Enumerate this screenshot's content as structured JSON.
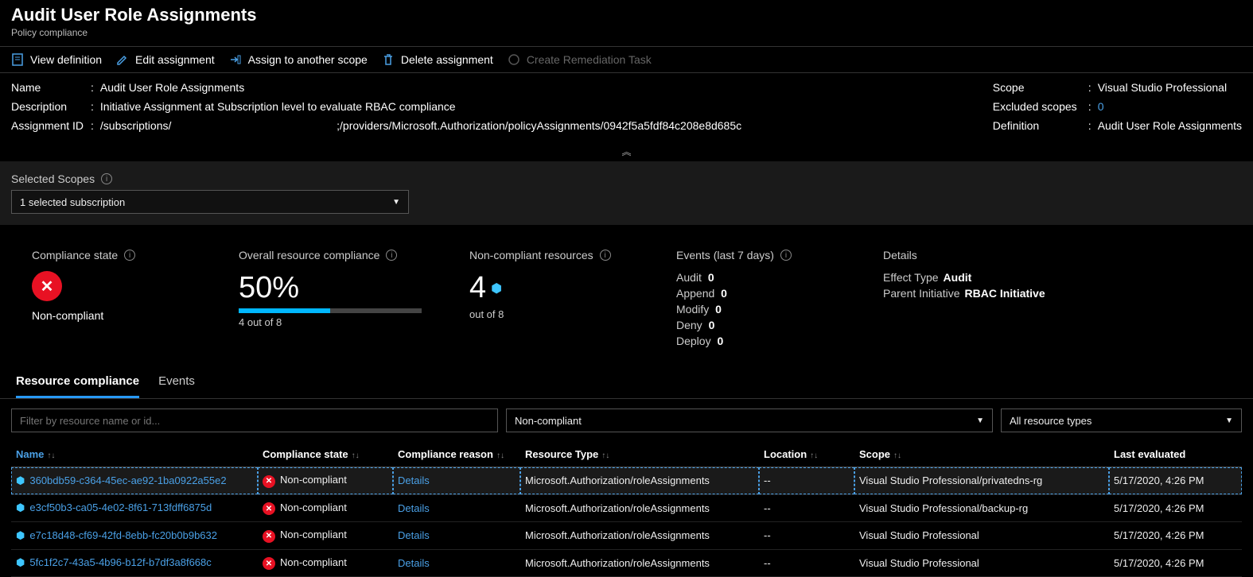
{
  "header": {
    "title": "Audit User Role Assignments",
    "subtitle": "Policy compliance"
  },
  "toolbar": {
    "view_definition": "View definition",
    "edit_assignment": "Edit assignment",
    "assign_scope": "Assign to another scope",
    "delete_assignment": "Delete assignment",
    "create_remediation": "Create Remediation Task"
  },
  "properties_left": {
    "name_label": "Name",
    "name_value": "Audit User Role Assignments",
    "description_label": "Description",
    "description_value": "Initiative Assignment at Subscription level to evaluate RBAC compliance",
    "assignment_id_label": "Assignment ID",
    "assignment_id_prefix": "/subscriptions/",
    "assignment_id_rest": ";/providers/Microsoft.Authorization/policyAssignments/0942f5a5fdf84c208e8d685c"
  },
  "properties_right": {
    "scope_label": "Scope",
    "scope_value": "Visual Studio Professional",
    "excluded_label": "Excluded scopes",
    "excluded_value": "0",
    "definition_label": "Definition",
    "definition_value": "Audit User Role Assignments"
  },
  "scopes": {
    "label": "Selected Scopes",
    "selected": "1 selected subscription"
  },
  "metrics": {
    "compliance_state_label": "Compliance state",
    "compliance_state_value": "Non-compliant",
    "overall_label": "Overall resource compliance",
    "overall_pct": "50%",
    "overall_sub": "4 out of 8",
    "noncompliant_label": "Non-compliant resources",
    "noncompliant_value": "4",
    "noncompliant_sub": "out of 8",
    "events_label": "Events (last 7 days)",
    "events": {
      "audit": "Audit",
      "audit_v": "0",
      "append": "Append",
      "append_v": "0",
      "modify": "Modify",
      "modify_v": "0",
      "deny": "Deny",
      "deny_v": "0",
      "deploy": "Deploy",
      "deploy_v": "0"
    },
    "details_label": "Details",
    "details": {
      "effect_k": "Effect Type",
      "effect_v": "Audit",
      "parent_k": "Parent Initiative",
      "parent_v": "RBAC Initiative"
    }
  },
  "tabs": {
    "resource_compliance": "Resource compliance",
    "events": "Events"
  },
  "filters": {
    "placeholder": "Filter by resource name or id...",
    "compliance_filter": "Non-compliant",
    "type_filter": "All resource types"
  },
  "columns": {
    "name": "Name",
    "compliance_state": "Compliance state",
    "compliance_reason": "Compliance reason",
    "resource_type": "Resource Type",
    "location": "Location",
    "scope": "Scope",
    "last_evaluated": "Last evaluated"
  },
  "rows": [
    {
      "name": "360bdb59-c364-45ec-ae92-1ba0922a55e2",
      "state": "Non-compliant",
      "reason": "Details",
      "type": "Microsoft.Authorization/roleAssignments",
      "location": "--",
      "scope": "Visual Studio Professional/privatedns-rg",
      "evaluated": "5/17/2020, 4:26 PM"
    },
    {
      "name": "e3cf50b3-ca05-4e02-8f61-713fdff6875d",
      "state": "Non-compliant",
      "reason": "Details",
      "type": "Microsoft.Authorization/roleAssignments",
      "location": "--",
      "scope": "Visual Studio Professional/backup-rg",
      "evaluated": "5/17/2020, 4:26 PM"
    },
    {
      "name": "e7c18d48-cf69-42fd-8ebb-fc20b0b9b632",
      "state": "Non-compliant",
      "reason": "Details",
      "type": "Microsoft.Authorization/roleAssignments",
      "location": "--",
      "scope": "Visual Studio Professional",
      "evaluated": "5/17/2020, 4:26 PM"
    },
    {
      "name": "5fc1f2c7-43a5-4b96-b12f-b7df3a8f668c",
      "state": "Non-compliant",
      "reason": "Details",
      "type": "Microsoft.Authorization/roleAssignments",
      "location": "--",
      "scope": "Visual Studio Professional",
      "evaluated": "5/17/2020, 4:26 PM"
    }
  ]
}
